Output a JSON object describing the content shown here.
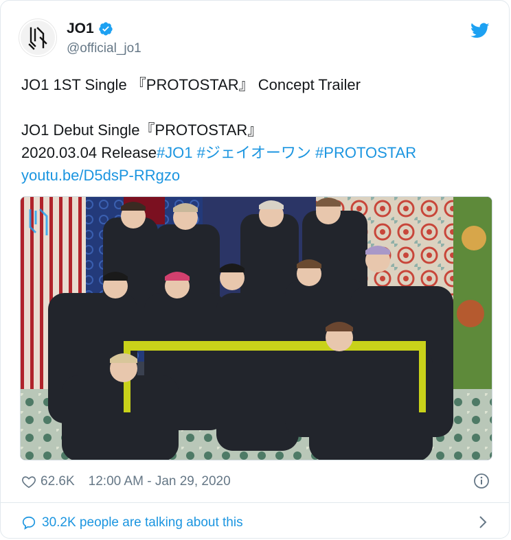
{
  "account": {
    "display_name": "JO1",
    "handle": "@official_jo1",
    "verified": true,
    "brand_color": "#1da1f2"
  },
  "tweet": {
    "lines": [
      "JO1 1ST Single 『PROTOSTAR』 Concept Trailer",
      "",
      "JO1 Debut Single『PROTOSTAR』"
    ],
    "release_text": "2020.03.04 Release",
    "hashtags": [
      "#JO1",
      "#ジェイオーワン",
      "#PROTOSTAR"
    ],
    "link": "youtu.be/D5dsP-RRgzo"
  },
  "footer": {
    "likes": "62.6K",
    "timestamp": "12:00 AM - Jan 29, 2020"
  },
  "talking": {
    "label": "30.2K people are talking about this"
  },
  "icons": {
    "like": "heart-icon",
    "info": "info-icon",
    "reply": "speech-bubble-icon",
    "chevron": "chevron-right-icon",
    "platform": "twitter-bird-icon",
    "verified": "verified-badge-icon"
  },
  "colors": {
    "link": "#1b95e0",
    "muted": "#657786",
    "text": "#14171a",
    "border": "#e1e8ed"
  }
}
